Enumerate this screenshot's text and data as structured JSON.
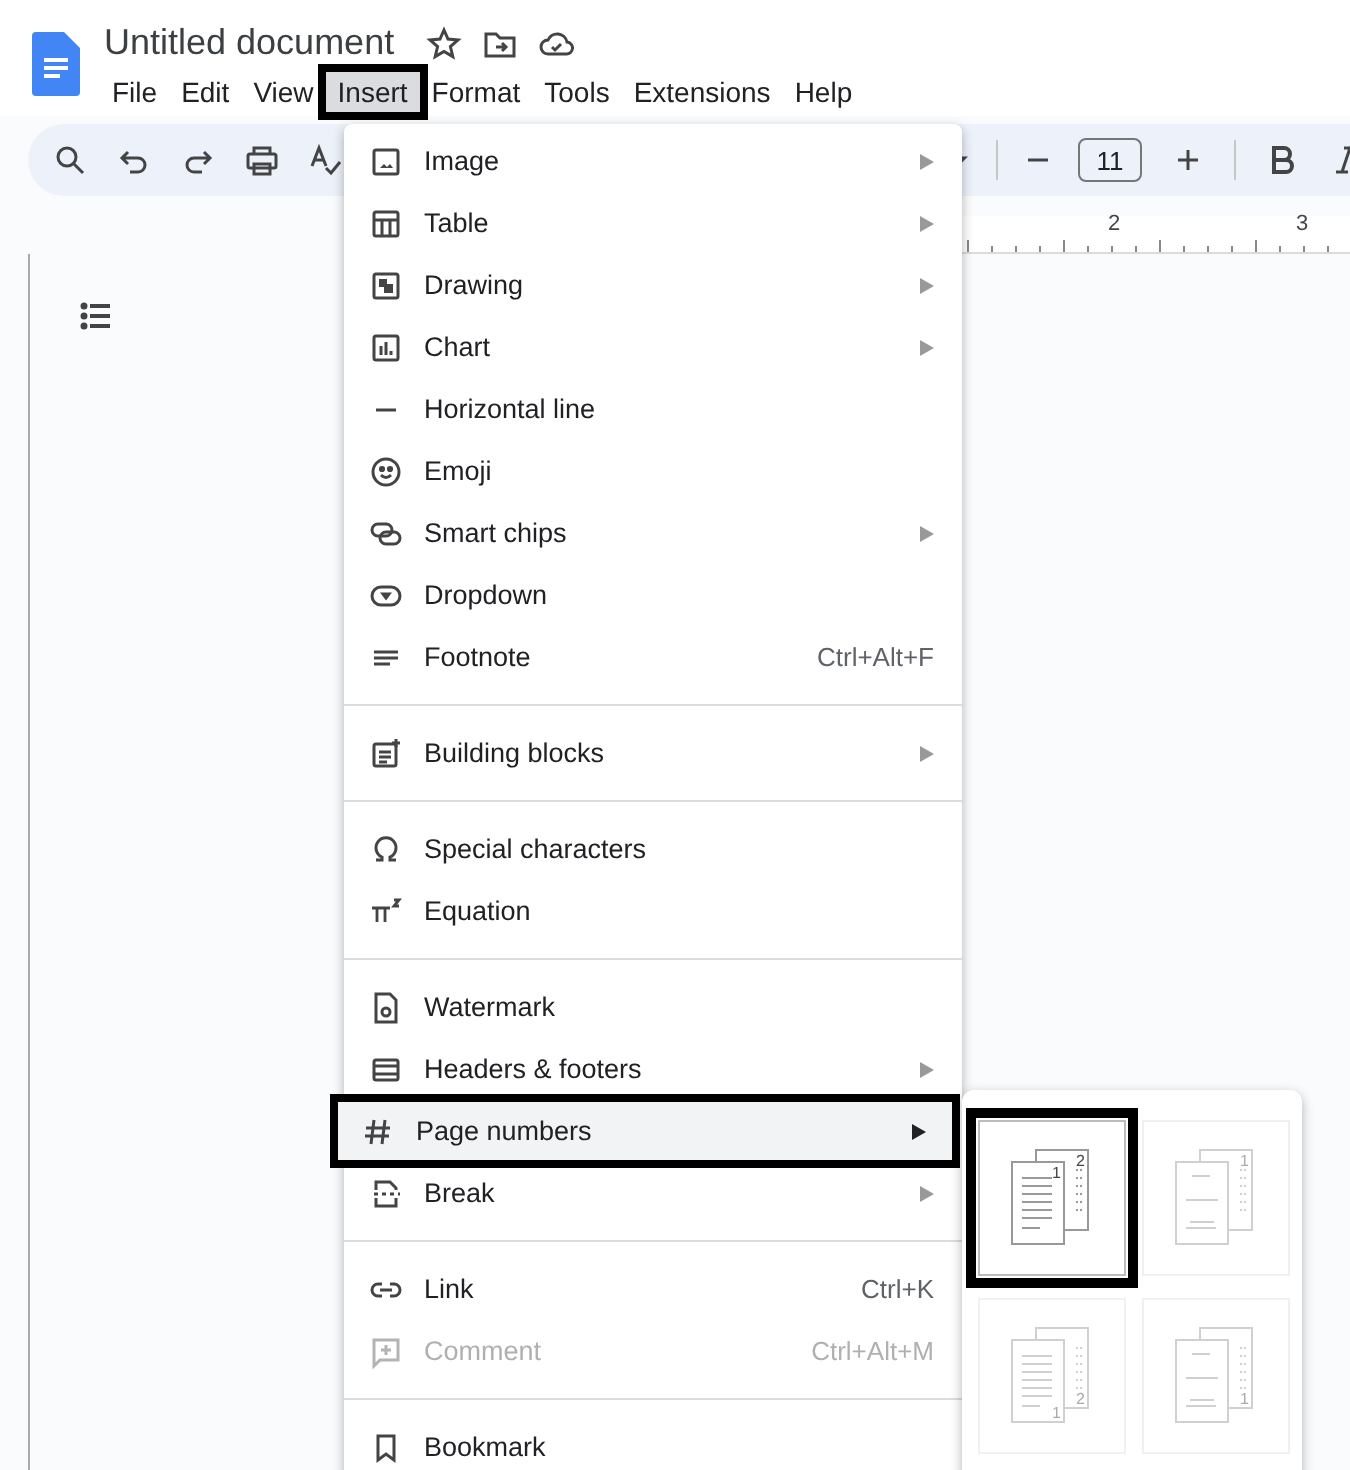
{
  "document": {
    "title": "Untitled document"
  },
  "menu_bar": [
    {
      "label": "File",
      "selected": false
    },
    {
      "label": "Edit",
      "selected": false
    },
    {
      "label": "View",
      "selected": false
    },
    {
      "label": "Insert",
      "selected": true
    },
    {
      "label": "Format",
      "selected": false
    },
    {
      "label": "Tools",
      "selected": false
    },
    {
      "label": "Extensions",
      "selected": false
    },
    {
      "label": "Help",
      "selected": false
    }
  ],
  "toolbar": {
    "font_size": "11"
  },
  "ruler": {
    "labels": [
      "2",
      "3"
    ]
  },
  "insert_menu": {
    "sections": [
      {
        "items": [
          {
            "label": "Image",
            "submenu": true,
            "disabled": false,
            "selected": false
          },
          {
            "label": "Table",
            "submenu": true,
            "disabled": false,
            "selected": false
          },
          {
            "label": "Drawing",
            "submenu": true,
            "disabled": false,
            "selected": false
          },
          {
            "label": "Chart",
            "submenu": true,
            "disabled": false,
            "selected": false
          },
          {
            "label": "Horizontal line",
            "submenu": false,
            "disabled": false,
            "selected": false
          },
          {
            "label": "Emoji",
            "submenu": false,
            "disabled": false,
            "selected": false
          },
          {
            "label": "Smart chips",
            "submenu": true,
            "disabled": false,
            "selected": false
          },
          {
            "label": "Dropdown",
            "submenu": false,
            "disabled": false,
            "selected": false
          },
          {
            "label": "Footnote",
            "shortcut": "Ctrl+Alt+F",
            "submenu": false,
            "disabled": false,
            "selected": false
          }
        ]
      },
      {
        "items": [
          {
            "label": "Building blocks",
            "submenu": true,
            "disabled": false,
            "selected": false
          }
        ]
      },
      {
        "items": [
          {
            "label": "Special characters",
            "submenu": false,
            "disabled": false,
            "selected": false
          },
          {
            "label": "Equation",
            "submenu": false,
            "disabled": false,
            "selected": false
          }
        ]
      },
      {
        "items": [
          {
            "label": "Watermark",
            "submenu": false,
            "disabled": false,
            "selected": false
          },
          {
            "label": "Headers & footers",
            "submenu": true,
            "disabled": false,
            "selected": false
          },
          {
            "label": "Page numbers",
            "submenu": true,
            "disabled": false,
            "selected": true
          },
          {
            "label": "Break",
            "submenu": true,
            "disabled": false,
            "selected": false
          }
        ]
      },
      {
        "items": [
          {
            "label": "Link",
            "shortcut": "Ctrl+K",
            "submenu": false,
            "disabled": false,
            "selected": false
          },
          {
            "label": "Comment",
            "shortcut": "Ctrl+Alt+M",
            "submenu": false,
            "disabled": true,
            "selected": false
          }
        ]
      },
      {
        "items": [
          {
            "label": "Bookmark",
            "submenu": false,
            "disabled": false,
            "selected": false
          }
        ]
      }
    ]
  },
  "page_number_options": [
    {
      "kind": "header",
      "front": "1",
      "back": "2",
      "selected": true
    },
    {
      "kind": "header",
      "back": "1",
      "selected": false
    },
    {
      "kind": "footer",
      "front": "1",
      "back": "2",
      "selected": false
    },
    {
      "kind": "footer",
      "back": "1",
      "selected": false
    }
  ]
}
